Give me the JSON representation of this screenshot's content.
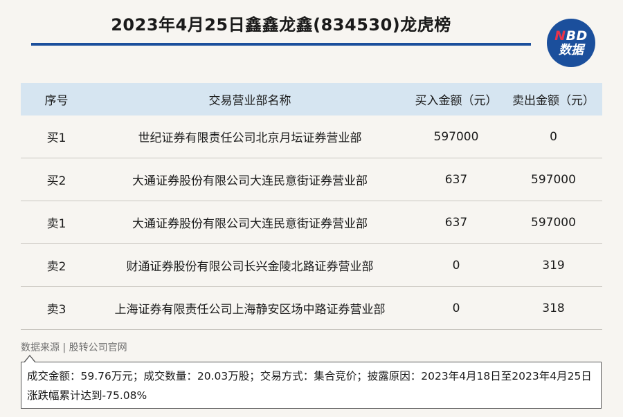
{
  "title": "2023年4月25日鑫鑫龙鑫(834530)龙虎榜",
  "logo": {
    "line1_n": "N",
    "line1_rest": "BD",
    "line2": "数据"
  },
  "table": {
    "headers": [
      "序号",
      "交易营业部名称",
      "买入金额（元）",
      "卖出金额（元）"
    ],
    "rows": [
      [
        "买1",
        "世纪证券有限责任公司北京月坛证券营业部",
        "597000",
        "0"
      ],
      [
        "买2",
        "大通证券股份有限公司大连民意街证券营业部",
        "637",
        "597000"
      ],
      [
        "卖1",
        "大通证券股份有限公司大连民意街证券营业部",
        "637",
        "597000"
      ],
      [
        "卖2",
        "财通证券股份有限公司长兴金陵北路证券营业部",
        "0",
        "319"
      ],
      [
        "卖3",
        "上海证券有限责任公司上海静安区场中路证券营业部",
        "0",
        "318"
      ]
    ]
  },
  "source": "数据来源 | 股转公司官网",
  "note": "成交金额：59.76万元；成交数量：20.03万股；交易方式：集合竞价；披露原因：2023年4月18日至2023年4月25日涨跌幅累计达到-75.08%",
  "colors": {
    "accent": "#1b4f9c",
    "header_bg": "#d6e5f1",
    "logo_n": "#e8344a"
  }
}
